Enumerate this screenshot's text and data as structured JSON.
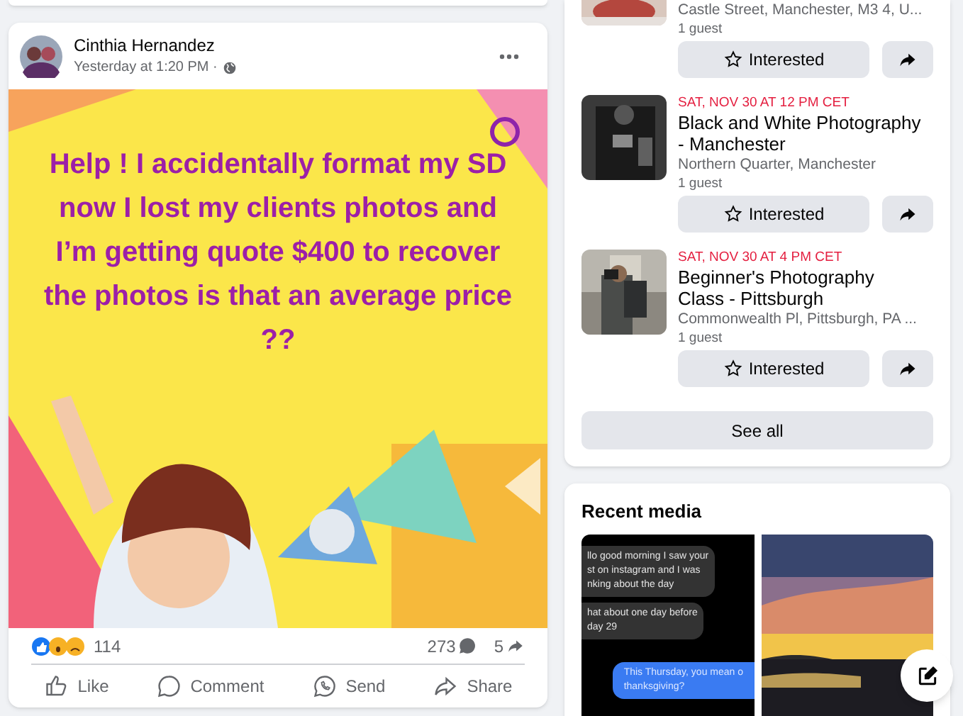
{
  "post": {
    "author": "Cinthia Hernandez",
    "time": "Yesterday at 1:20 PM ·",
    "image_text": "Help ! I accidentally format my SD now I lost my clients photos and I’m getting quote $400 to recover the photos is that an average price ??",
    "reaction_count": "114",
    "comment_count": "273",
    "share_count": "5",
    "actions": [
      {
        "kind": "like",
        "label": "Like"
      },
      {
        "kind": "comment",
        "label": "Comment"
      },
      {
        "kind": "send",
        "label": "Send"
      },
      {
        "kind": "share",
        "label": "Share"
      }
    ]
  },
  "events": [
    {
      "location": "Castle Street, Manchester, M3 4, U...",
      "guests": "1 guest",
      "button": "Interested"
    },
    {
      "date": "SAT, NOV 30 AT 12 PM CET",
      "title": "Black and White Photography - Manchester",
      "location": "Northern Quarter, Manchester",
      "guests": "1 guest",
      "button": "Interested"
    },
    {
      "date": "SAT, NOV 30 AT 4 PM CET",
      "title": "Beginner's Photography Class - Pittsburgh",
      "location": "Commonwealth Pl, Pittsburgh, PA ...",
      "guests": "1 guest",
      "button": "Interested"
    }
  ],
  "see_all": "See all",
  "recent_media": {
    "title": "Recent media",
    "chat": [
      {
        "mine": false,
        "lines": [
          "llo good morning I saw your",
          "st on instagram and I was",
          "nking about the day"
        ]
      },
      {
        "mine": false,
        "lines": [
          "hat about one day before",
          "day 29"
        ]
      },
      {
        "mine": true,
        "lines": [
          "This Thursday, you mean o",
          "thanksgiving?"
        ]
      }
    ]
  }
}
